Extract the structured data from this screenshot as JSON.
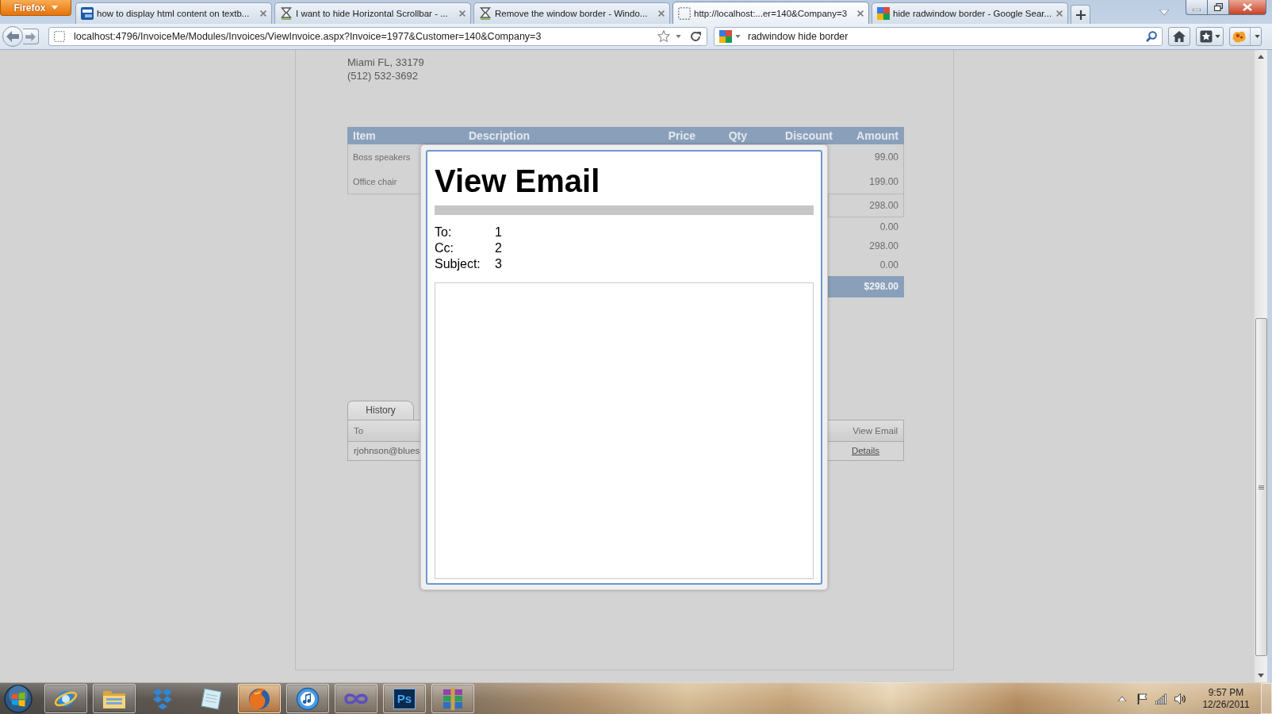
{
  "browser": {
    "menu_button": {
      "label": "Firefox"
    },
    "tabs": [
      {
        "title": "how to display html content on textb...",
        "kind": "tile",
        "selected": false
      },
      {
        "title": "I want to hide Horizontal Scrollbar - ...",
        "kind": "hourglass",
        "selected": false
      },
      {
        "title": "Remove the window border - Windo...",
        "kind": "hourglass",
        "selected": false
      },
      {
        "title": "http://localhost:...er=140&Company=3",
        "kind": "blank",
        "selected": true
      },
      {
        "title": "hide radwindow border - Google Sear...",
        "kind": "blocks",
        "selected": false
      }
    ],
    "address_bar": {
      "value": "localhost:4796/InvoiceMe/Modules/Invoices/ViewInvoice.aspx?Invoice=1977&Customer=140&Company=3"
    },
    "search_bar": {
      "value": "radwindow hide border"
    }
  },
  "page": {
    "address_lines": [
      "Miami FL, 33179",
      "(512) 532-3692"
    ],
    "invoice_table": {
      "columns": [
        "Item",
        "Description",
        "Price",
        "Qty",
        "Discount",
        "Amount"
      ],
      "rows": [
        {
          "item": "Boss speakers",
          "amount": "99.00"
        },
        {
          "item": "Office chair",
          "amount": "199.00"
        }
      ],
      "totals": [
        {
          "kind": "subtotal",
          "value": "298.00"
        },
        {
          "kind": "line",
          "value": "0.00"
        },
        {
          "kind": "line",
          "value": "298.00"
        },
        {
          "kind": "line",
          "value": "0.00"
        },
        {
          "kind": "grand",
          "value": "$298.00"
        }
      ]
    },
    "history": {
      "tabs": [
        {
          "label": "History",
          "selected": true
        }
      ],
      "columns": [
        "To",
        "View Email"
      ],
      "rows": [
        {
          "to": "rjohnson@blues",
          "link": "Details"
        }
      ]
    }
  },
  "dialog": {
    "title": "View Email",
    "fields": [
      {
        "label": "To:",
        "value": "1"
      },
      {
        "label": "Cc:",
        "value": "2"
      },
      {
        "label": "Subject:",
        "value": "3"
      }
    ]
  },
  "taskbar": {
    "items": [
      {
        "kind": "browser",
        "running": true,
        "selected": false
      },
      {
        "kind": "files",
        "running": true,
        "selected": false
      },
      {
        "kind": "sync",
        "running": false,
        "selected": false
      },
      {
        "kind": "notes",
        "running": false,
        "selected": false
      },
      {
        "kind": "webbrowser",
        "running": true,
        "selected": true
      },
      {
        "kind": "music",
        "running": true,
        "selected": false
      },
      {
        "kind": "loop",
        "running": true,
        "selected": false
      },
      {
        "kind": "photo",
        "label": "Ps",
        "running": true,
        "selected": false
      },
      {
        "kind": "archive",
        "running": true,
        "selected": false
      }
    ],
    "clock": {
      "time": "9:57 PM",
      "date": "12/26/2011"
    }
  }
}
